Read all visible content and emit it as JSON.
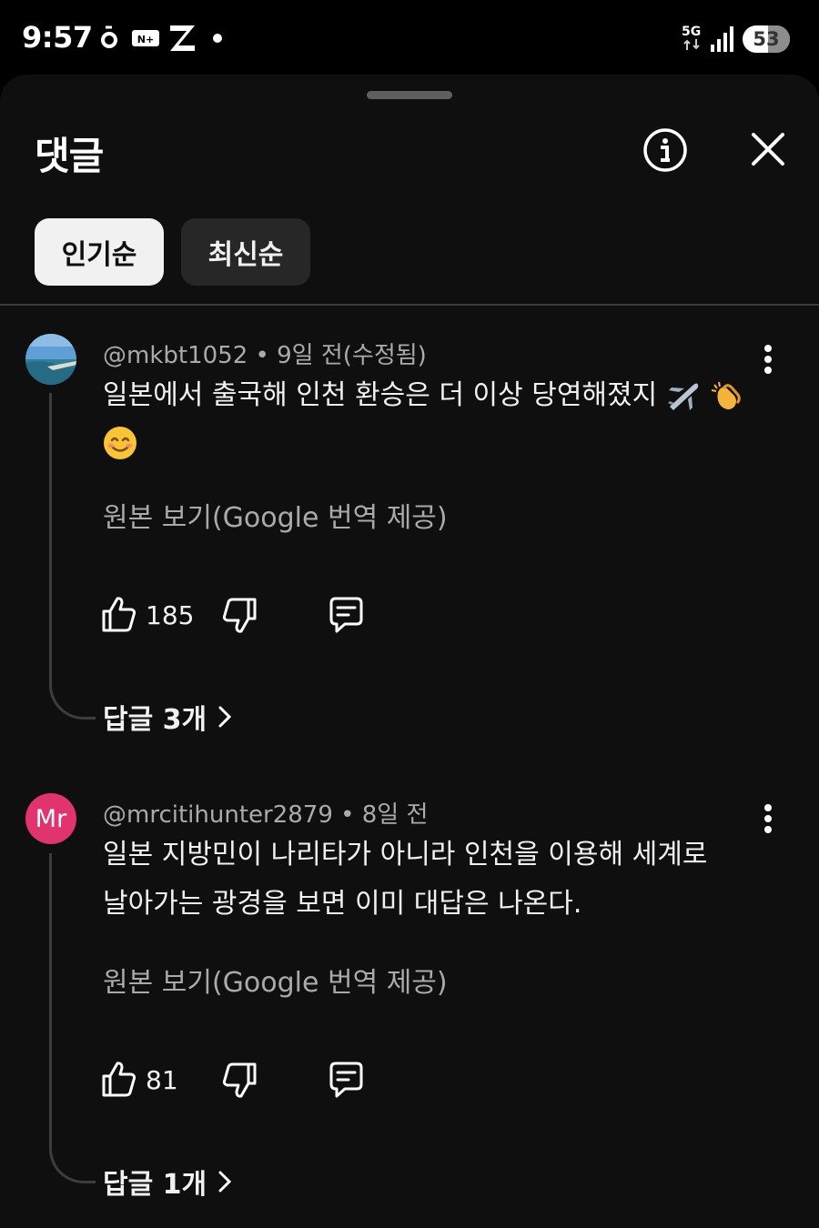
{
  "status_bar": {
    "time": "9:57",
    "network": "5G",
    "battery": "53"
  },
  "sheet": {
    "title": "댓글",
    "sort_tabs": [
      {
        "label": "인기순",
        "active": true
      },
      {
        "label": "최신순",
        "active": false
      }
    ]
  },
  "comments": [
    {
      "author": "@mkbt1052",
      "meta": " • 9일 전(수정됨)",
      "avatar": "landscape-photo",
      "text_lines": [
        "일본에서 출국해 인천 환승은 더 이상 당연해졌지"
      ],
      "emojis": [
        "airplane",
        "clapping-hands",
        "smiling-face"
      ],
      "translate_label": "원본 보기(Google 번역 제공)",
      "likes": "185",
      "replies_label": "답글 3개"
    },
    {
      "author": "@mrcitihunter2879",
      "meta": " • 8일 전",
      "avatar_initials": "Mr",
      "avatar_color": "#e1336e",
      "text_lines": [
        "일본 지방민이 나리타가 아니라 인천을 이용해 세계로",
        "날아가는 광경을 보면 이미 대답은 나온다."
      ],
      "translate_label": "원본 보기(Google 번역 제공)",
      "likes": "81",
      "replies_label": "답글 1개"
    }
  ],
  "colors": {
    "background": "#0f0f0f",
    "text": "#f1f1f1",
    "secondary_text": "#aaaaaa",
    "chip_active": "#f1f1f1",
    "chip_inactive": "#272727"
  }
}
